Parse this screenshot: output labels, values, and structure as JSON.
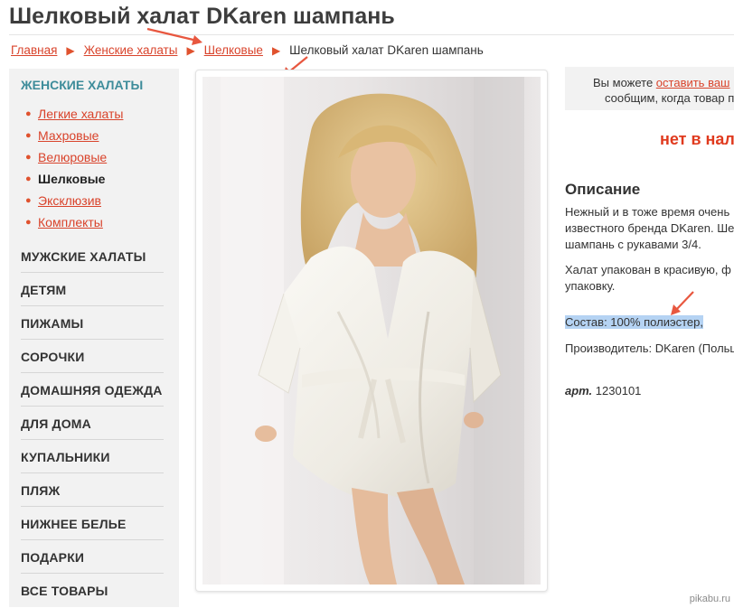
{
  "title": "Шелковый халат DKaren шампань",
  "breadcrumb": {
    "home": "Главная",
    "category": "Женские халаты",
    "subcategory": "Шелковые",
    "current": "Шелковый халат DKaren шампань"
  },
  "sidebar": {
    "category_title": "ЖЕНСКИЕ ХАЛАТЫ",
    "subcategories": [
      "Легкие халаты",
      "Махровые",
      "Велюровые",
      "Шелковые",
      "Эксклюзив",
      "Комплекты"
    ],
    "main_categories": [
      "МУЖСКИЕ ХАЛАТЫ",
      "ДЕТЯМ",
      "ПИЖАМЫ",
      "СОРОЧКИ",
      "ДОМАШНЯЯ ОДЕЖДА",
      "ДЛЯ ДОМА",
      "КУПАЛЬНИКИ",
      "ПЛЯЖ",
      "НИЖНЕЕ БЕЛЬЕ",
      "ПОДАРКИ",
      "ВСЕ ТОВАРЫ"
    ]
  },
  "notice": {
    "prefix": "Вы можете ",
    "link": "оставить ваш",
    "line2": "сообщим, когда товар п"
  },
  "status": "нет в нал",
  "description": {
    "heading": "Описание",
    "p1_line1": "Нежный и в тоже время очень",
    "p1_line2": "известного бренда DKaren. Ше",
    "p1_line3": "шампань с рукавами 3/4.",
    "p2_line1": "Халат упакован в красивую, ф",
    "p2_line2": "упаковку.",
    "composition": "Состав: 100% полиэстер,",
    "manufacturer": "Производитель: DKaren (Польш",
    "article_label": "арт.",
    "article_value": "1230101"
  },
  "watermark": "pikabu.ru",
  "colors": {
    "link": "#d9432b",
    "arrow": "#e8573f",
    "category_title": "#3d8c9a",
    "status": "#e03a1e",
    "highlight": "#b5d3f3"
  }
}
